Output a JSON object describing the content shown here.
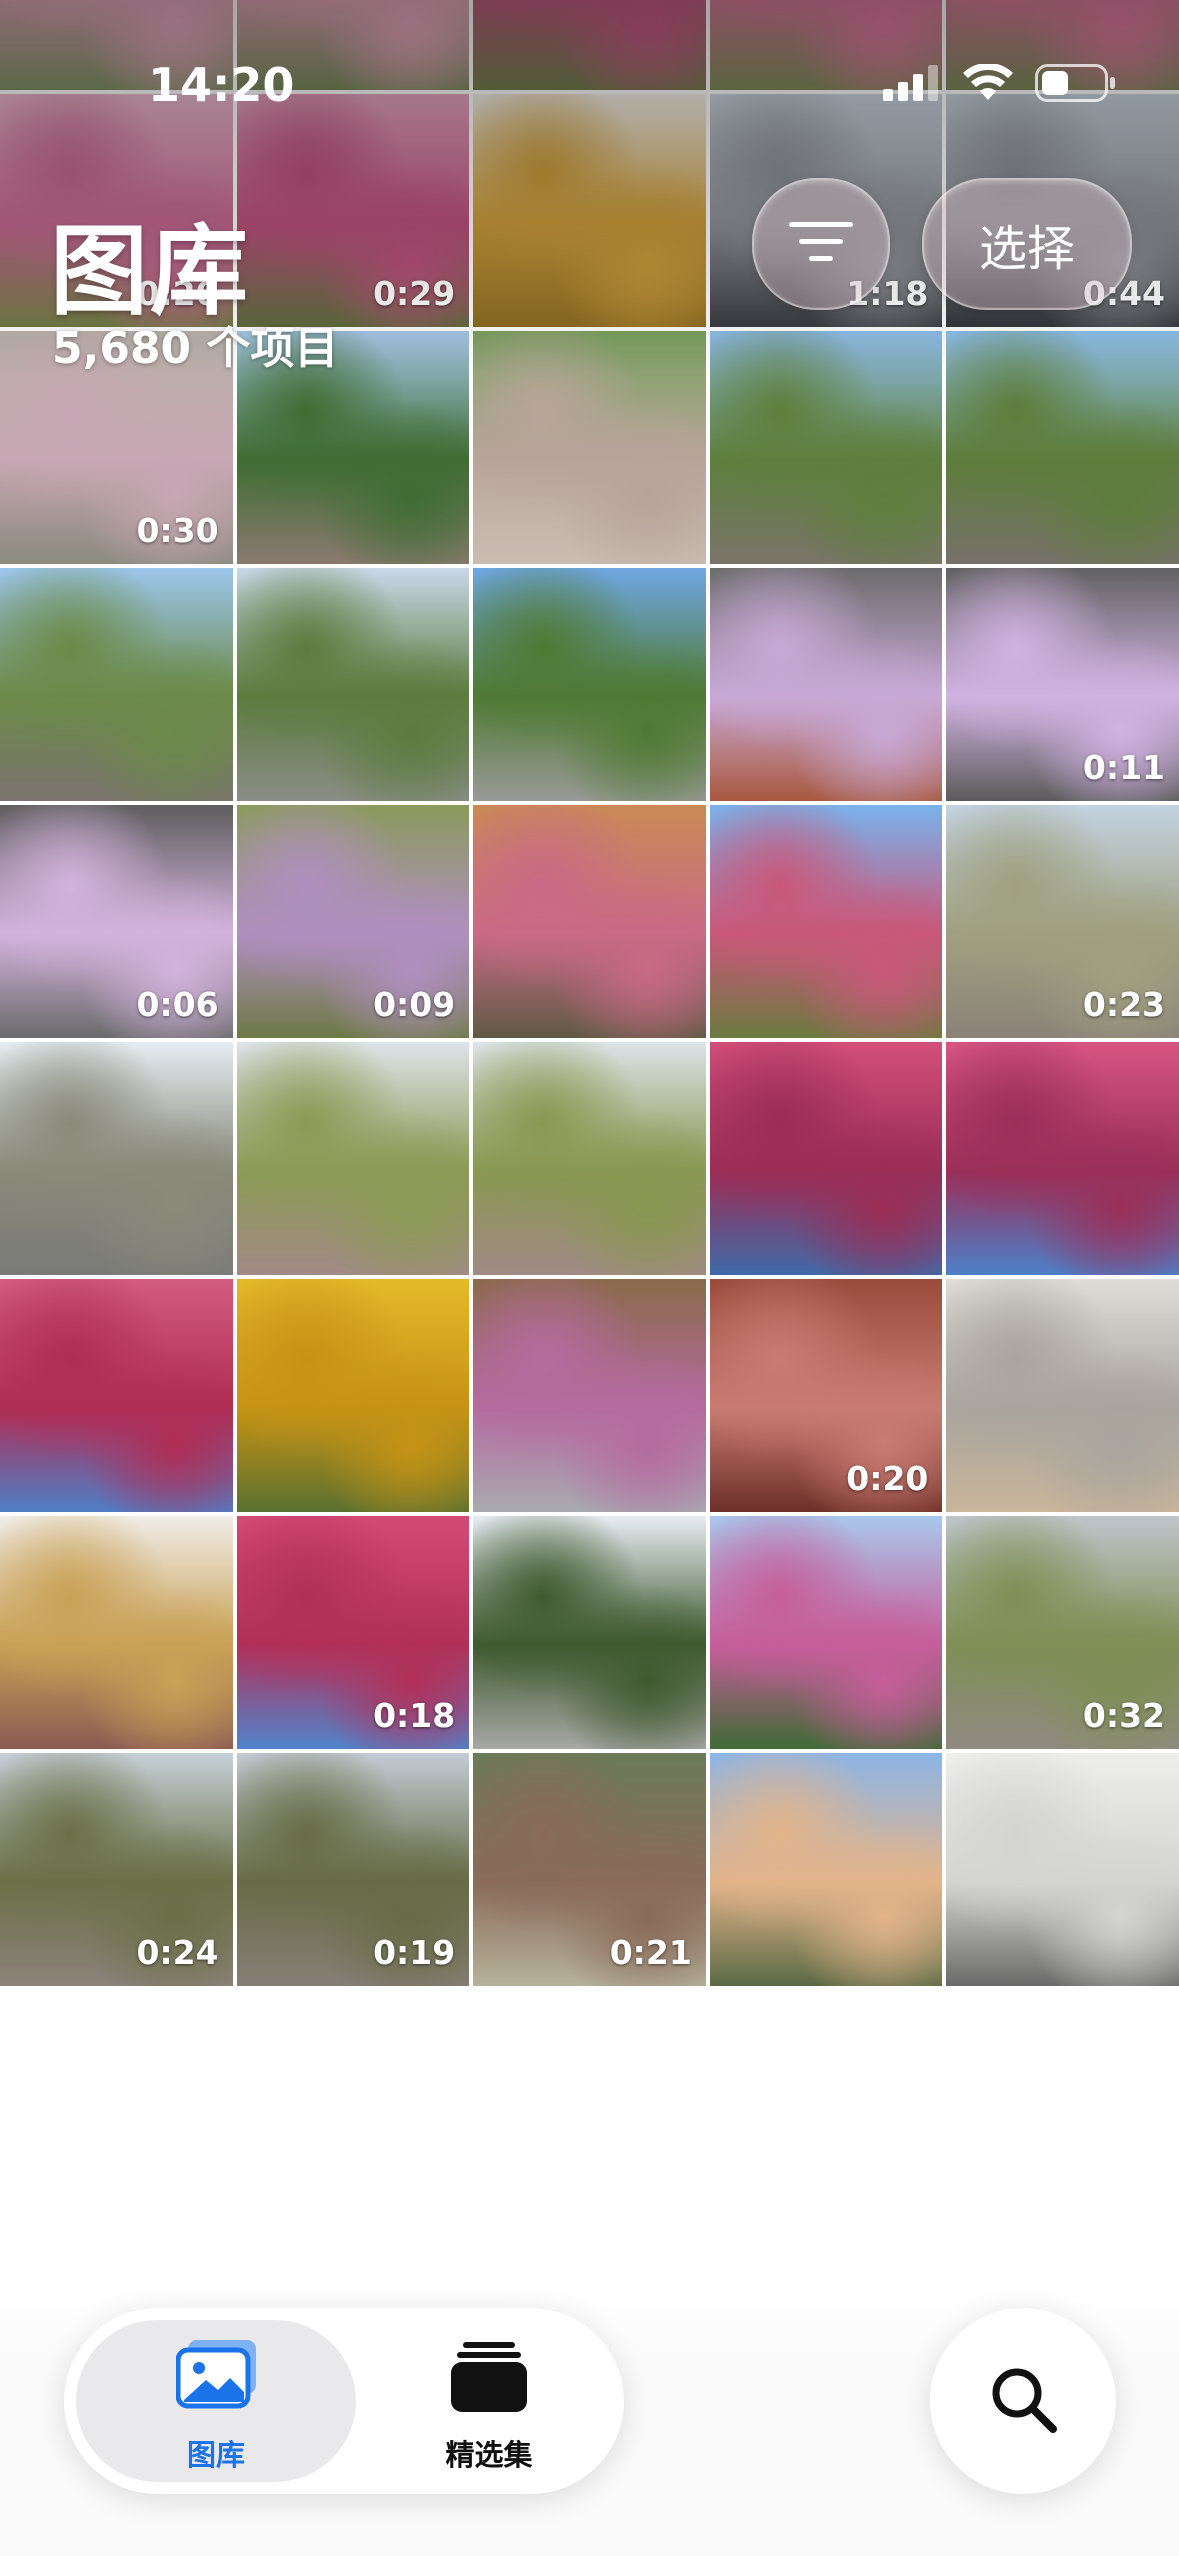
{
  "status_bar": {
    "time": "14:20"
  },
  "header": {
    "title": "图库",
    "item_count": "5,680 个项目",
    "select_label": "选择"
  },
  "grid": {
    "rows": [
      [
        {
          "colors": [
            "#cfd9e0",
            "#e6a7c0",
            "#7e8f62"
          ],
          "duration": ""
        },
        {
          "colors": [
            "#d3dbe2",
            "#e9a7bf",
            "#77885a"
          ],
          "duration": ""
        },
        {
          "colors": [
            "#d8a3b6",
            "#c85a86",
            "#6f7e4c"
          ],
          "duration": ""
        },
        {
          "colors": [
            "#d9bac6",
            "#e07aa2",
            "#7d8a58"
          ],
          "duration": ""
        },
        {
          "colors": [
            "#d6b9c5",
            "#df7ba0",
            "#7a8758"
          ],
          "duration": ""
        }
      ],
      [
        {
          "colors": [
            "#e8b6c8",
            "#c2668f",
            "#6f7a45"
          ],
          "duration": "0:20"
        },
        {
          "colors": [
            "#e3a3bd",
            "#b9507b",
            "#5d6b3d"
          ],
          "duration": "0:29"
        },
        {
          "colors": [
            "#f3efe8",
            "#c89a3a",
            "#8a6b22"
          ],
          "duration": ""
        },
        {
          "colors": [
            "#c9d4de",
            "#8c9096",
            "#3a3b40"
          ],
          "duration": "1:18"
        },
        {
          "colors": [
            "#c7d2dc",
            "#8b8f95",
            "#35363b"
          ],
          "duration": "0:44"
        }
      ],
      [
        {
          "colors": [
            "#b8b1a9",
            "#c7a7b3",
            "#8a8a7d"
          ],
          "duration": "0:30"
        },
        {
          "colors": [
            "#a7c8e8",
            "#3f6d33",
            "#8a7a70"
          ],
          "duration": ""
        },
        {
          "colors": [
            "#7aa05f",
            "#b8a59a",
            "#cbbdb3"
          ],
          "duration": ""
        },
        {
          "colors": [
            "#8fbde8",
            "#5e7f3c",
            "#7a746a"
          ],
          "duration": ""
        },
        {
          "colors": [
            "#8fc0ea",
            "#5d7d3a",
            "#77716a"
          ],
          "duration": ""
        }
      ],
      [
        {
          "colors": [
            "#9cc6ec",
            "#6b8a48",
            "#7c7470"
          ],
          "duration": ""
        },
        {
          "colors": [
            "#c9d8e8",
            "#5b7c3e",
            "#8b8c87"
          ],
          "duration": ""
        },
        {
          "colors": [
            "#6fa7e4",
            "#4f7a33",
            "#9a9a98"
          ],
          "duration": ""
        },
        {
          "colors": [
            "#6c6c6c",
            "#c8a9d6",
            "#a8583e"
          ],
          "duration": ""
        },
        {
          "colors": [
            "#616161",
            "#d1b3e2",
            "#5b5b5b"
          ],
          "duration": "0:11"
        }
      ],
      [
        {
          "colors": [
            "#5e5e5e",
            "#d3b3dd",
            "#6b6b6b"
          ],
          "duration": "0:06"
        },
        {
          "colors": [
            "#8a9a5c",
            "#b08fc0",
            "#6d7a45"
          ],
          "duration": "0:09"
        },
        {
          "colors": [
            "#c98a55",
            "#c96a86",
            "#5f5a44"
          ],
          "duration": ""
        },
        {
          "colors": [
            "#79b3ec",
            "#c9587a",
            "#6b7a3f"
          ],
          "duration": ""
        },
        {
          "colors": [
            "#c3d3e2",
            "#a0a080",
            "#8b8278"
          ],
          "duration": "0:23"
        }
      ],
      [
        {
          "colors": [
            "#e5ecf2",
            "#8a8a7a",
            "#7a7a78"
          ],
          "duration": ""
        },
        {
          "colors": [
            "#dfe4ea",
            "#8b9a55",
            "#a38a86"
          ],
          "duration": ""
        },
        {
          "colors": [
            "#dde3e8",
            "#899851",
            "#a18986"
          ],
          "duration": ""
        },
        {
          "colors": [
            "#d24f7a",
            "#9b2d55",
            "#3f6aa8"
          ],
          "duration": ""
        },
        {
          "colors": [
            "#d75581",
            "#9a2f58",
            "#4c80c8"
          ],
          "duration": ""
        }
      ],
      [
        {
          "colors": [
            "#d25c7f",
            "#b02d55",
            "#4f7ec6"
          ],
          "duration": ""
        },
        {
          "colors": [
            "#e6b82a",
            "#c69315",
            "#5a7030"
          ],
          "duration": ""
        },
        {
          "colors": [
            "#8a6a4a",
            "#b56ba0",
            "#a8aab0"
          ],
          "duration": ""
        },
        {
          "colors": [
            "#9a4b3c",
            "#c97b72",
            "#6d2f28"
          ],
          "duration": "0:20"
        },
        {
          "colors": [
            "#e0dcd8",
            "#a9a59e",
            "#c9b59a"
          ],
          "duration": ""
        }
      ],
      [
        {
          "colors": [
            "#f0ede8",
            "#c9a156",
            "#8a5a52"
          ],
          "duration": ""
        },
        {
          "colors": [
            "#d34a76",
            "#b23058",
            "#4f84cc"
          ],
          "duration": "0:18"
        },
        {
          "colors": [
            "#e7ecf2",
            "#3f5a2f",
            "#a8a8a6"
          ],
          "duration": ""
        },
        {
          "colors": [
            "#a9c8ec",
            "#c65e9a",
            "#3f6a36"
          ],
          "duration": ""
        },
        {
          "colors": [
            "#bfc6cc",
            "#7f8f55",
            "#908a82"
          ],
          "duration": "0:32"
        }
      ],
      [
        {
          "colors": [
            "#c6d0d8",
            "#6b7048",
            "#8c827a"
          ],
          "duration": "0:24"
        },
        {
          "colors": [
            "#c3ccd5",
            "#676c46",
            "#877e76"
          ],
          "duration": "0:19"
        },
        {
          "colors": [
            "#6b7b5a",
            "#8a6b5a",
            "#b6b39a"
          ],
          "duration": "0:21"
        },
        {
          "colors": [
            "#8cb5e6",
            "#e2b48a",
            "#5a6a45"
          ],
          "duration": ""
        },
        {
          "colors": [
            "#eeeeec",
            "#d4d4d2",
            "#6a6a6a"
          ],
          "duration": ""
        }
      ]
    ]
  },
  "tab_bar": {
    "library_label": "图库",
    "collections_label": "精选集",
    "active_color": "#1a73e8"
  },
  "icons": {
    "status": [
      "cellular-signal-icon",
      "wifi-icon",
      "battery-icon"
    ],
    "header": [
      "filter-icon"
    ],
    "tabs": [
      "photo-library-icon",
      "collections-stack-icon"
    ],
    "search": [
      "search-icon"
    ]
  }
}
